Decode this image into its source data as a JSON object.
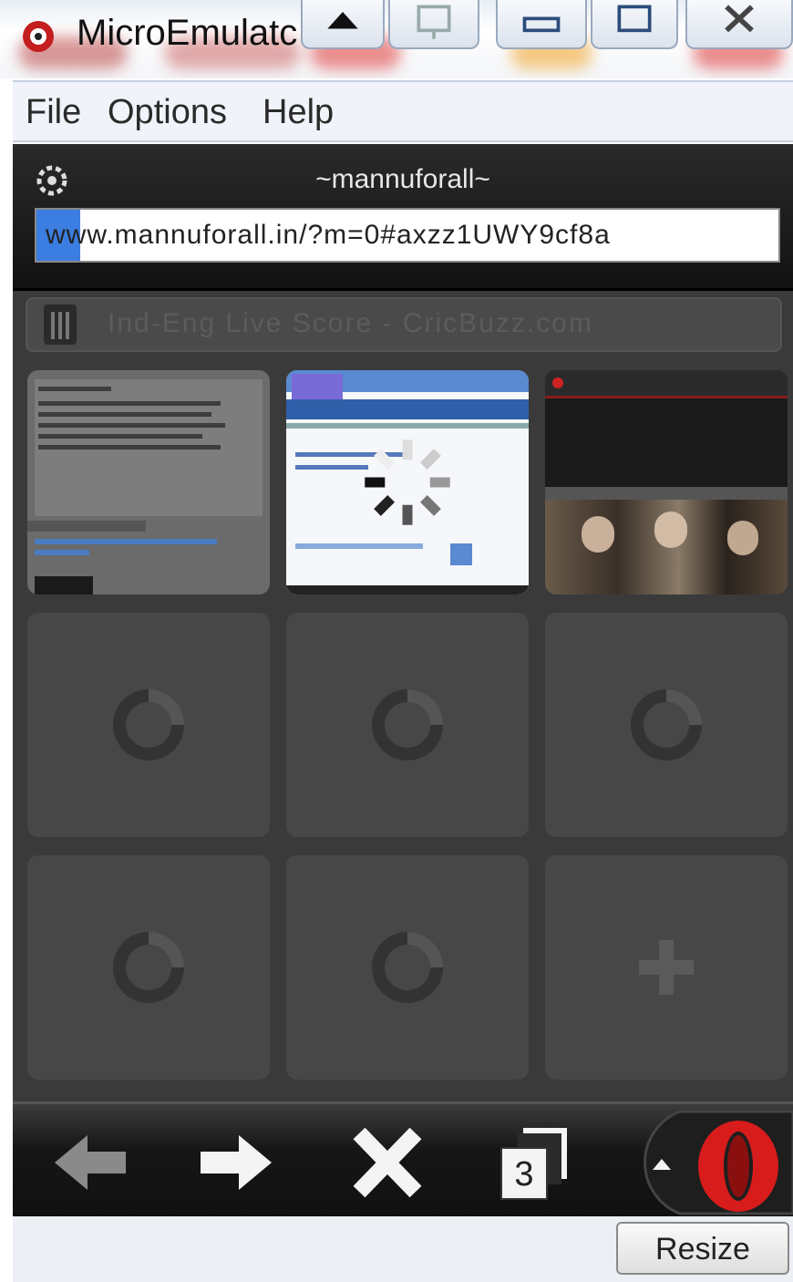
{
  "window": {
    "title": "MicroEmulatc"
  },
  "menu": {
    "file": "File",
    "options": "Options",
    "help": "Help"
  },
  "browser": {
    "site_title": "~mannuforall~",
    "url": "www.mannuforall.in/?m=0#axzz1UWY9cf8a",
    "suggestion": "Ind-Eng Live Score - CricBuzz.com",
    "tab_count": "3"
  },
  "bottom": {
    "resize_label": "Resize"
  },
  "colors": {
    "opera_red": "#d81b1b",
    "url_selection": "#3b7de0",
    "dial_cell": "#474747"
  },
  "icons": {
    "back": "left-arrow-icon",
    "forward": "right-arrow-icon",
    "stop": "x-icon",
    "tabs": "tabs-icon",
    "menu": "opera-logo-icon"
  }
}
